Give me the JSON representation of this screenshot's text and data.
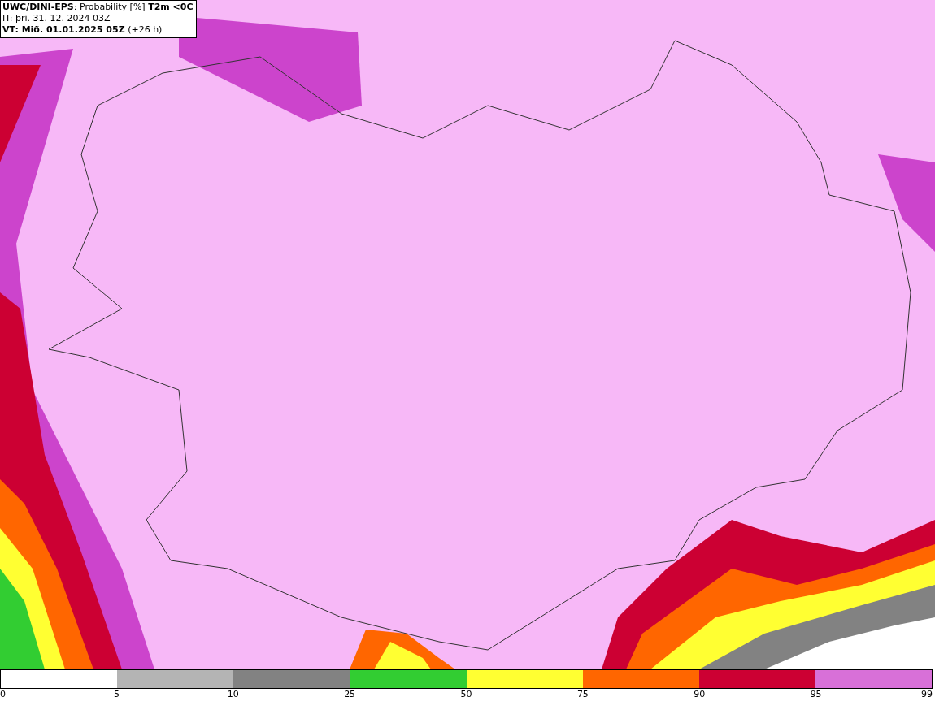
{
  "header": {
    "title": "**UWC/DINI-EPS**: Probability [%] **T2m <0C**",
    "issue_time": "IT: þri. 31. 12. 2024 03Z",
    "valid_time": "**VT: Mið. 01.01.2025 05Z** (+26 h)"
  },
  "legend": {
    "segments": [
      {
        "color": "#ffffff"
      },
      {
        "color": "#b4b4b4"
      },
      {
        "color": "#828282"
      },
      {
        "color": "#32cd32"
      },
      {
        "color": "#ffff32"
      },
      {
        "color": "#ff6600"
      },
      {
        "color": "#cc0033"
      },
      {
        "color": "#d870d8"
      }
    ],
    "ticks": [
      "0",
      "5",
      "10",
      "25",
      "50",
      "75",
      "90",
      "95",
      "99"
    ]
  }
}
